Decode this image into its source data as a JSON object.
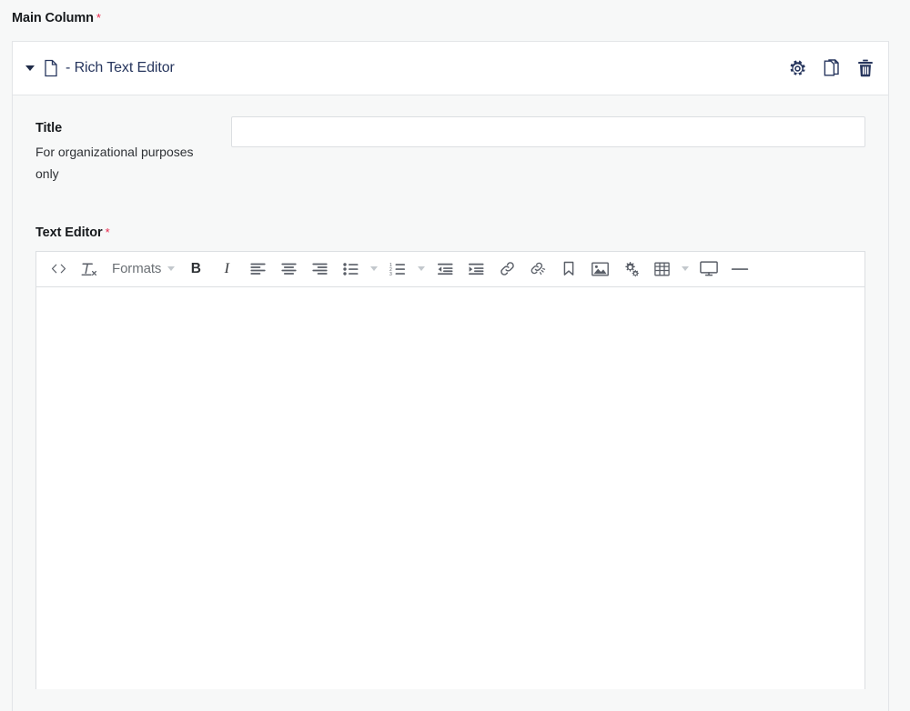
{
  "page": {
    "column_label": "Main Column",
    "column_required_marker": "*"
  },
  "card": {
    "header": {
      "collapse_icon": "caret-down-icon",
      "type_icon": "document-icon",
      "title": "- Rich Text Editor",
      "actions": [
        {
          "name": "settings",
          "icon": "gear-icon",
          "label": "Settings"
        },
        {
          "name": "duplicate",
          "icon": "copy-pages-icon",
          "label": "Duplicate"
        },
        {
          "name": "delete",
          "icon": "trash-icon",
          "label": "Delete"
        }
      ]
    },
    "fields": {
      "title": {
        "label": "Title",
        "help_text": "For organizational purposes only",
        "value": "",
        "placeholder": ""
      },
      "text_editor": {
        "label": "Text Editor",
        "required_marker": "*",
        "content": ""
      }
    }
  },
  "toolbar": {
    "items": [
      {
        "id": "source-code",
        "icon": "source-code-icon",
        "label": "<>",
        "type": "icon"
      },
      {
        "id": "clear-formatting",
        "icon": "clear-formatting-icon",
        "label": "Tx",
        "type": "icon"
      },
      {
        "id": "formats",
        "icon": "formats-dropdown",
        "label": "Formats",
        "type": "dropdown"
      },
      {
        "id": "bold",
        "icon": "bold-icon",
        "label": "B",
        "type": "text"
      },
      {
        "id": "italic",
        "icon": "italic-icon",
        "label": "I",
        "type": "text"
      },
      {
        "id": "align-left",
        "icon": "align-left-icon",
        "label": "Align left",
        "type": "icon"
      },
      {
        "id": "align-center",
        "icon": "align-center-icon",
        "label": "Align center",
        "type": "icon"
      },
      {
        "id": "align-right",
        "icon": "align-right-icon",
        "label": "Align right",
        "type": "icon"
      },
      {
        "id": "bullet-list",
        "icon": "bullet-list-icon",
        "label": "Bullet list",
        "type": "split"
      },
      {
        "id": "numbered-list",
        "icon": "numbered-list-icon",
        "label": "Numbered list",
        "type": "split"
      },
      {
        "id": "outdent",
        "icon": "outdent-icon",
        "label": "Decrease indent",
        "type": "icon"
      },
      {
        "id": "indent",
        "icon": "indent-icon",
        "label": "Increase indent",
        "type": "icon"
      },
      {
        "id": "link",
        "icon": "link-icon",
        "label": "Insert link",
        "type": "icon"
      },
      {
        "id": "unlink",
        "icon": "unlink-icon",
        "label": "Remove link",
        "type": "icon"
      },
      {
        "id": "anchor",
        "icon": "bookmark-icon",
        "label": "Anchor",
        "type": "icon"
      },
      {
        "id": "image",
        "icon": "image-icon",
        "label": "Insert image",
        "type": "icon"
      },
      {
        "id": "settings-gears",
        "icon": "double-gear-icon",
        "label": "Tools",
        "type": "icon"
      },
      {
        "id": "table",
        "icon": "table-icon",
        "label": "Table",
        "type": "split"
      },
      {
        "id": "preview",
        "icon": "monitor-icon",
        "label": "Preview",
        "type": "icon"
      },
      {
        "id": "horizontal-rule",
        "icon": "horizontal-rule-icon",
        "label": "Horizontal line",
        "type": "icon"
      }
    ]
  },
  "colors": {
    "page_background": "#f7f8f8",
    "card_background": "#ffffff",
    "border": "#e3e5e8",
    "header_title": "#27365e",
    "required_star": "#e8274b",
    "toolbar_icon": "#595e67",
    "label_text": "#16191c"
  }
}
